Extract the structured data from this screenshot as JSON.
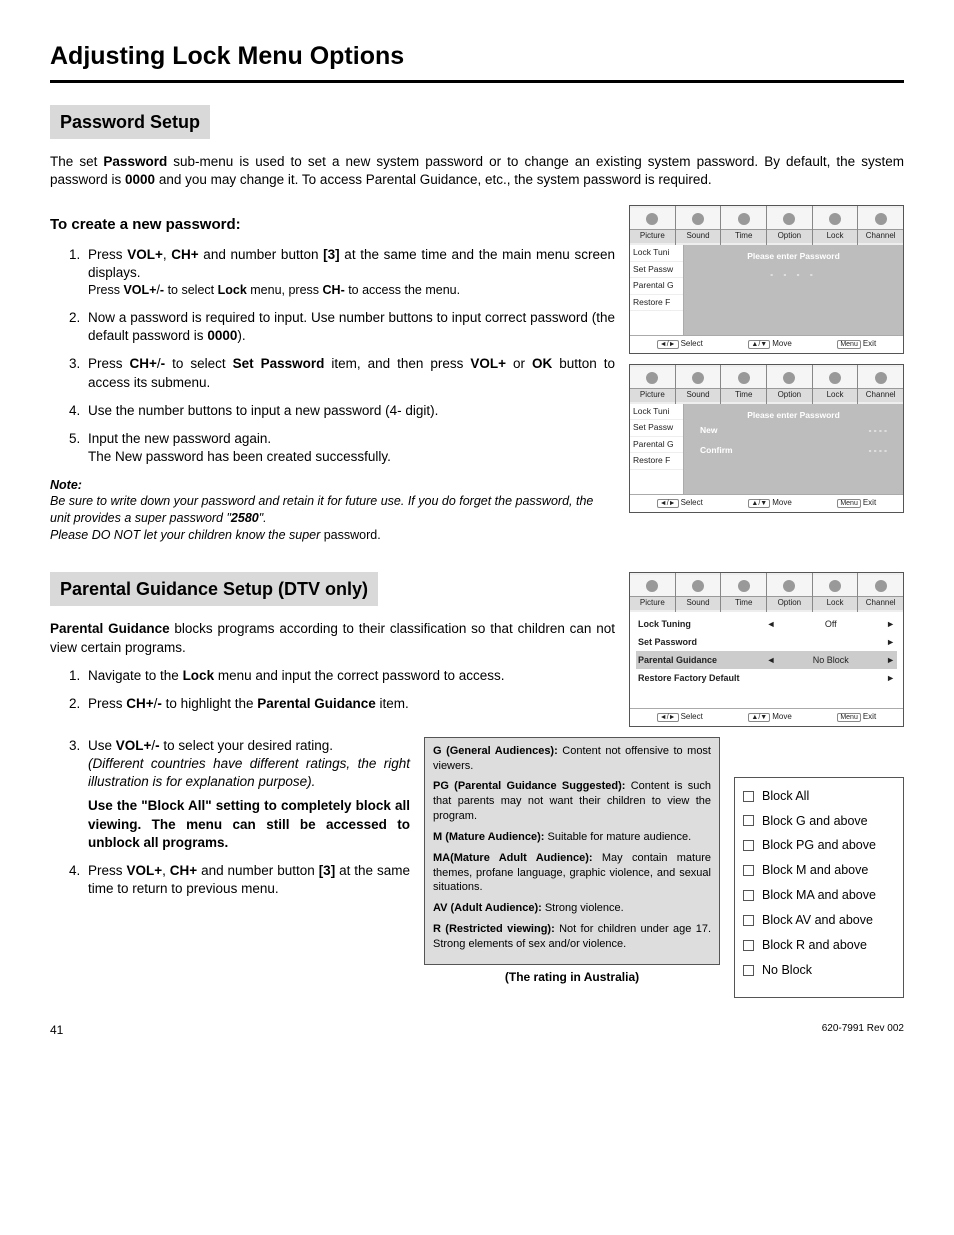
{
  "page_title": "Adjusting Lock Menu Options",
  "section1": {
    "title": "Password Setup",
    "intro_parts": [
      "The set ",
      "Password",
      " sub-menu is used to set a new system password or to change an existing system password. By default, the system password is ",
      "0000",
      " and you may change it. To access Parental Guidance, etc., the system password is required."
    ],
    "sub_heading": "To create a new password:",
    "steps": {
      "s1a": "Press ",
      "s1b": "VOL+",
      "s1c": ", ",
      "s1d": "CH+",
      "s1e": " and number button ",
      "s1f": "[3]",
      "s1g": " at the same time and the main menu screen displays.",
      "s1_small_a": "Press ",
      "s1_small_b": "VOL+",
      "s1_small_c": "/",
      "s1_small_d": "-",
      "s1_small_e": " to select ",
      "s1_small_f": "Lock",
      "s1_small_g": " menu, press ",
      "s1_small_h": "CH-",
      "s1_small_i": " to access the menu.",
      "s2a": "Now a password is required to input. Use number buttons to input correct password (the default password is ",
      "s2b": "0000",
      "s2c": ").",
      "s3a": "Press ",
      "s3b": "CH+",
      "s3c": "/",
      "s3d": "-",
      "s3e": " to select ",
      "s3f": "Set Password",
      "s3g": " item, and then press ",
      "s3h": "VOL+",
      "s3i": " or ",
      "s3j": "OK",
      "s3k": " button to access its submenu.",
      "s4": "Use the number buttons to input a new password (4- digit).",
      "s5a": "Input the new password again.",
      "s5b": "The New password has been created successfully."
    },
    "note_label": "Note:",
    "note_parts": [
      "Be sure to write down your password and retain it for future use. If you do forget the password, the unit provides a super password \"",
      "2580",
      "\".",
      "Please DO NOT let your children know the super ",
      "password."
    ]
  },
  "tv_tabs": [
    "Picture",
    "Sound",
    "Time",
    "Option",
    "Lock",
    "Channel"
  ],
  "tv1": {
    "side": [
      "Lock Tuni",
      "Set Passw",
      "Parental G",
      "Restore F"
    ],
    "main_title": "Please enter Password",
    "dots": "- - - -"
  },
  "tv2": {
    "side": [
      "Lock Tuni",
      "Set Passw",
      "Parental G",
      "Restore F"
    ],
    "main_title": "Please enter Password",
    "row_new": "New",
    "row_new_v": "- - - -",
    "row_conf": "Confirm",
    "row_conf_v": "- - - -"
  },
  "tv3": {
    "rows": [
      {
        "label": "Lock Tuning",
        "value": "Off",
        "arrows": true
      },
      {
        "label": "Set Password",
        "value": "",
        "arrows_right": true
      },
      {
        "label": "Parental Guidance",
        "value": "No Block",
        "arrows": true,
        "selected": true
      },
      {
        "label": "Restore Factory Default",
        "value": "",
        "arrows_right": true
      }
    ]
  },
  "tv_footer": {
    "a": "Select",
    "b": "Move",
    "c": "Exit",
    "ka": "◄/►",
    "kb": "▲/▼",
    "kc": "Menu"
  },
  "section2": {
    "title": "Parental Guidance Setup (DTV only)",
    "intro_a": "Parental Guidance",
    "intro_b": " blocks programs according to their classification so that children can not view certain programs.",
    "steps": {
      "s1a": "Navigate to the ",
      "s1b": "Lock",
      "s1c": " menu and input the correct password to access.",
      "s2a": "Press ",
      "s2b": "CH+",
      "s2c": "/",
      "s2d": "-",
      "s2e": " to highlight the ",
      "s2f": "Parental Guidance",
      "s2g": " item.",
      "s3a": "Use ",
      "s3b": "VOL+",
      "s3c": "/",
      "s3d": "-",
      "s3e": " to select your desired rating.",
      "s3_ital": "(Different countries have different ratings, the right illustration is for explanation purpose).",
      "s3_bold": "Use the \"Block All\" setting to completely block all viewing. The menu can still be accessed to unblock all programs.",
      "s4a": "Press ",
      "s4b": "VOL+",
      "s4c": ", ",
      "s4d": "CH+",
      "s4e": " and number button ",
      "s4f": "[3]",
      "s4g": " at the same time to return to previous menu."
    }
  },
  "ratings": [
    {
      "t": "G (General Audiences):",
      "d": " Content not offensive to most viewers."
    },
    {
      "t": "PG (Parental Guidance Suggested):",
      "d": " Content is such that parents may not want their children to view the program."
    },
    {
      "t": "M (Mature Audience):",
      "d": " Suitable for mature audience."
    },
    {
      "t": "MA(Mature Adult Audience):",
      "d": " May contain mature themes, profane language, graphic violence, and sexual situations."
    },
    {
      "t": "AV (Adult Audience):",
      "d": " Strong violence."
    },
    {
      "t": "R (Restricted viewing):",
      "d": " Not for children under age 17. Strong elements of sex and/or violence."
    }
  ],
  "ratings_caption": "(The rating in Australia)",
  "block_options": [
    "Block All",
    "Block G and above",
    "Block PG and above",
    "Block M and above",
    "Block MA and above",
    "Block AV and above",
    "Block R and above",
    "No Block"
  ],
  "footer": {
    "page": "41",
    "doc": "620-7991 Rev 002"
  }
}
